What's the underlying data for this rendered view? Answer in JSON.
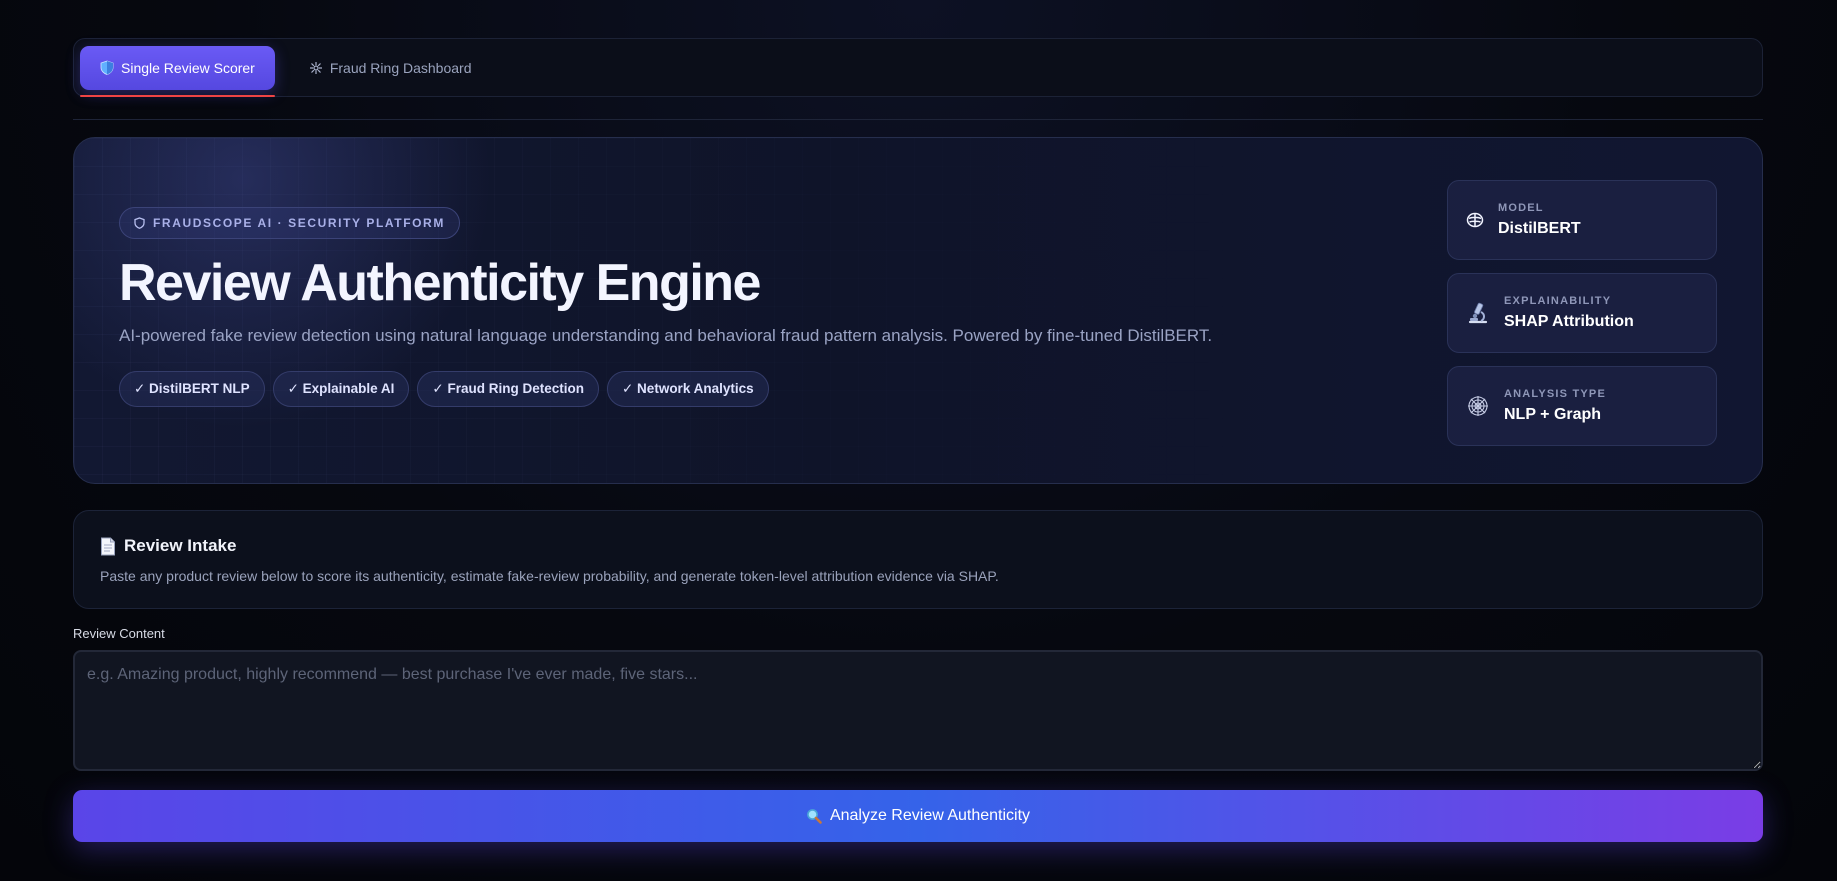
{
  "tabs": [
    {
      "label": "Single Review Scorer",
      "icon": "shield-icon",
      "active": true
    },
    {
      "label": "Fraud Ring Dashboard",
      "icon": "network-icon",
      "active": false
    }
  ],
  "hero": {
    "eyebrow": "FRAUDSCOPE AI · SECURITY PLATFORM",
    "title": "Review Authenticity Engine",
    "description": "AI-powered fake review detection using natural language understanding and behavioral fraud pattern analysis. Powered by fine-tuned DistilBERT.",
    "chips": [
      "✓ DistilBERT NLP",
      "✓ Explainable AI",
      "✓ Fraud Ring Detection",
      "✓ Network Analytics"
    ],
    "cards": [
      {
        "label": "MODEL",
        "value": "DistilBERT",
        "icon": "brain-icon"
      },
      {
        "label": "EXPLAINABILITY",
        "value": "SHAP Attribution",
        "icon": "microscope-icon"
      },
      {
        "label": "ANALYSIS TYPE",
        "value": "NLP + Graph",
        "icon": "web-icon"
      }
    ]
  },
  "intake": {
    "title": "Review Intake",
    "description": "Paste any product review below to score its authenticity, estimate fake-review probability, and generate token-level attribution evidence via SHAP."
  },
  "review_field": {
    "label": "Review Content",
    "placeholder": "e.g. Amazing product, highly recommend — best purchase I've ever made, five stars...",
    "value": ""
  },
  "analyze_button": {
    "label": "Analyze Review Authenticity"
  },
  "colors": {
    "accent": "#5a4cf0",
    "tab_underline": "#ef4444",
    "button_gradient_start": "#5a45e8",
    "button_gradient_end": "#7a3de6"
  }
}
